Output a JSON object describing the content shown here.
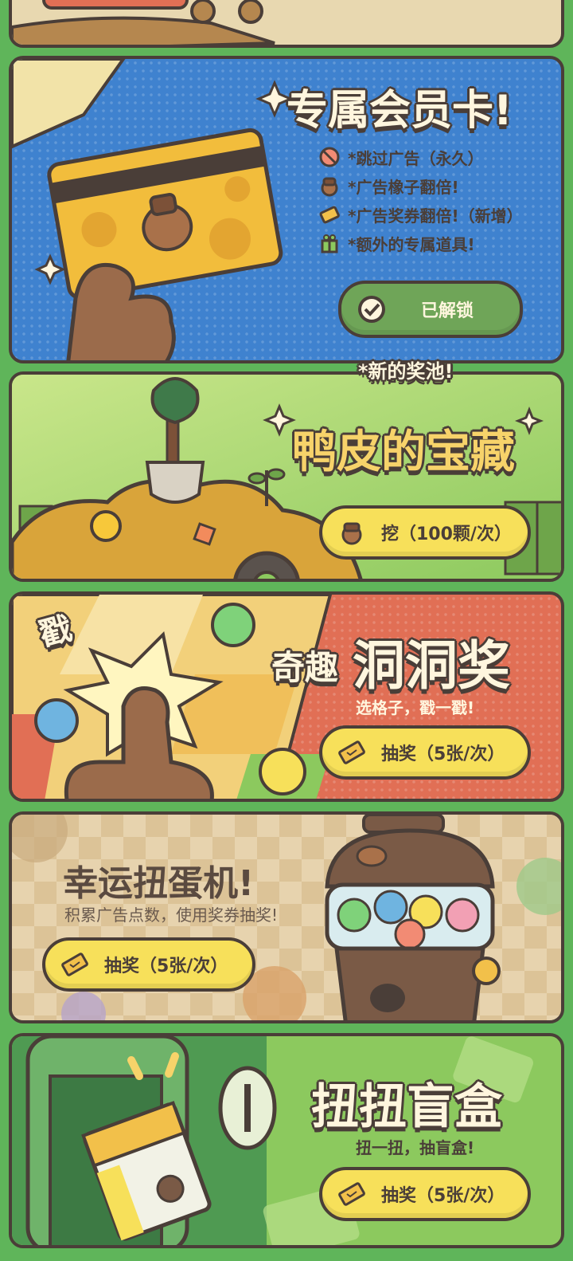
{
  "member_card": {
    "title": "专属会员卡!",
    "benefits": [
      {
        "icon": "no-ads-icon",
        "text": "*跳过广告（永久）"
      },
      {
        "icon": "acorn-icon",
        "text": "*广告橡子翻倍!"
      },
      {
        "icon": "ticket-icon",
        "text": "*广告奖券翻倍!（新增）"
      },
      {
        "icon": "gift-icon",
        "text": "*额外的专属道具!"
      }
    ],
    "button_label": "已解锁"
  },
  "new_pool_label": "*新的奖池!",
  "treasure": {
    "title": "鸭皮的宝藏",
    "button_label": "挖（100颗/次）"
  },
  "hole_prize": {
    "title_small": "奇趣",
    "title_big": "洞洞奖",
    "poke_label": "戳",
    "subtitle": "选格子，戳一戳!",
    "button_label": "抽奖（5张/次）"
  },
  "gacha": {
    "title": "幸运扭蛋机!",
    "subtitle": "积累广告点数，使用奖券抽奖!",
    "button_label": "抽奖（5张/次）"
  },
  "blind_box": {
    "title": "扭扭盲盒",
    "subtitle": "扭一扭，抽盲盒!",
    "button_label": "抽奖（5张/次）"
  },
  "colors": {
    "outline": "#4a3e38",
    "pill_yellow": "#f7e05a",
    "unlocked_green": "#6fa558",
    "blue_panel": "#3f82cf",
    "green_panel": "#8cc95e",
    "red_panel": "#e16f55",
    "beige_panel": "#d8bf96"
  }
}
